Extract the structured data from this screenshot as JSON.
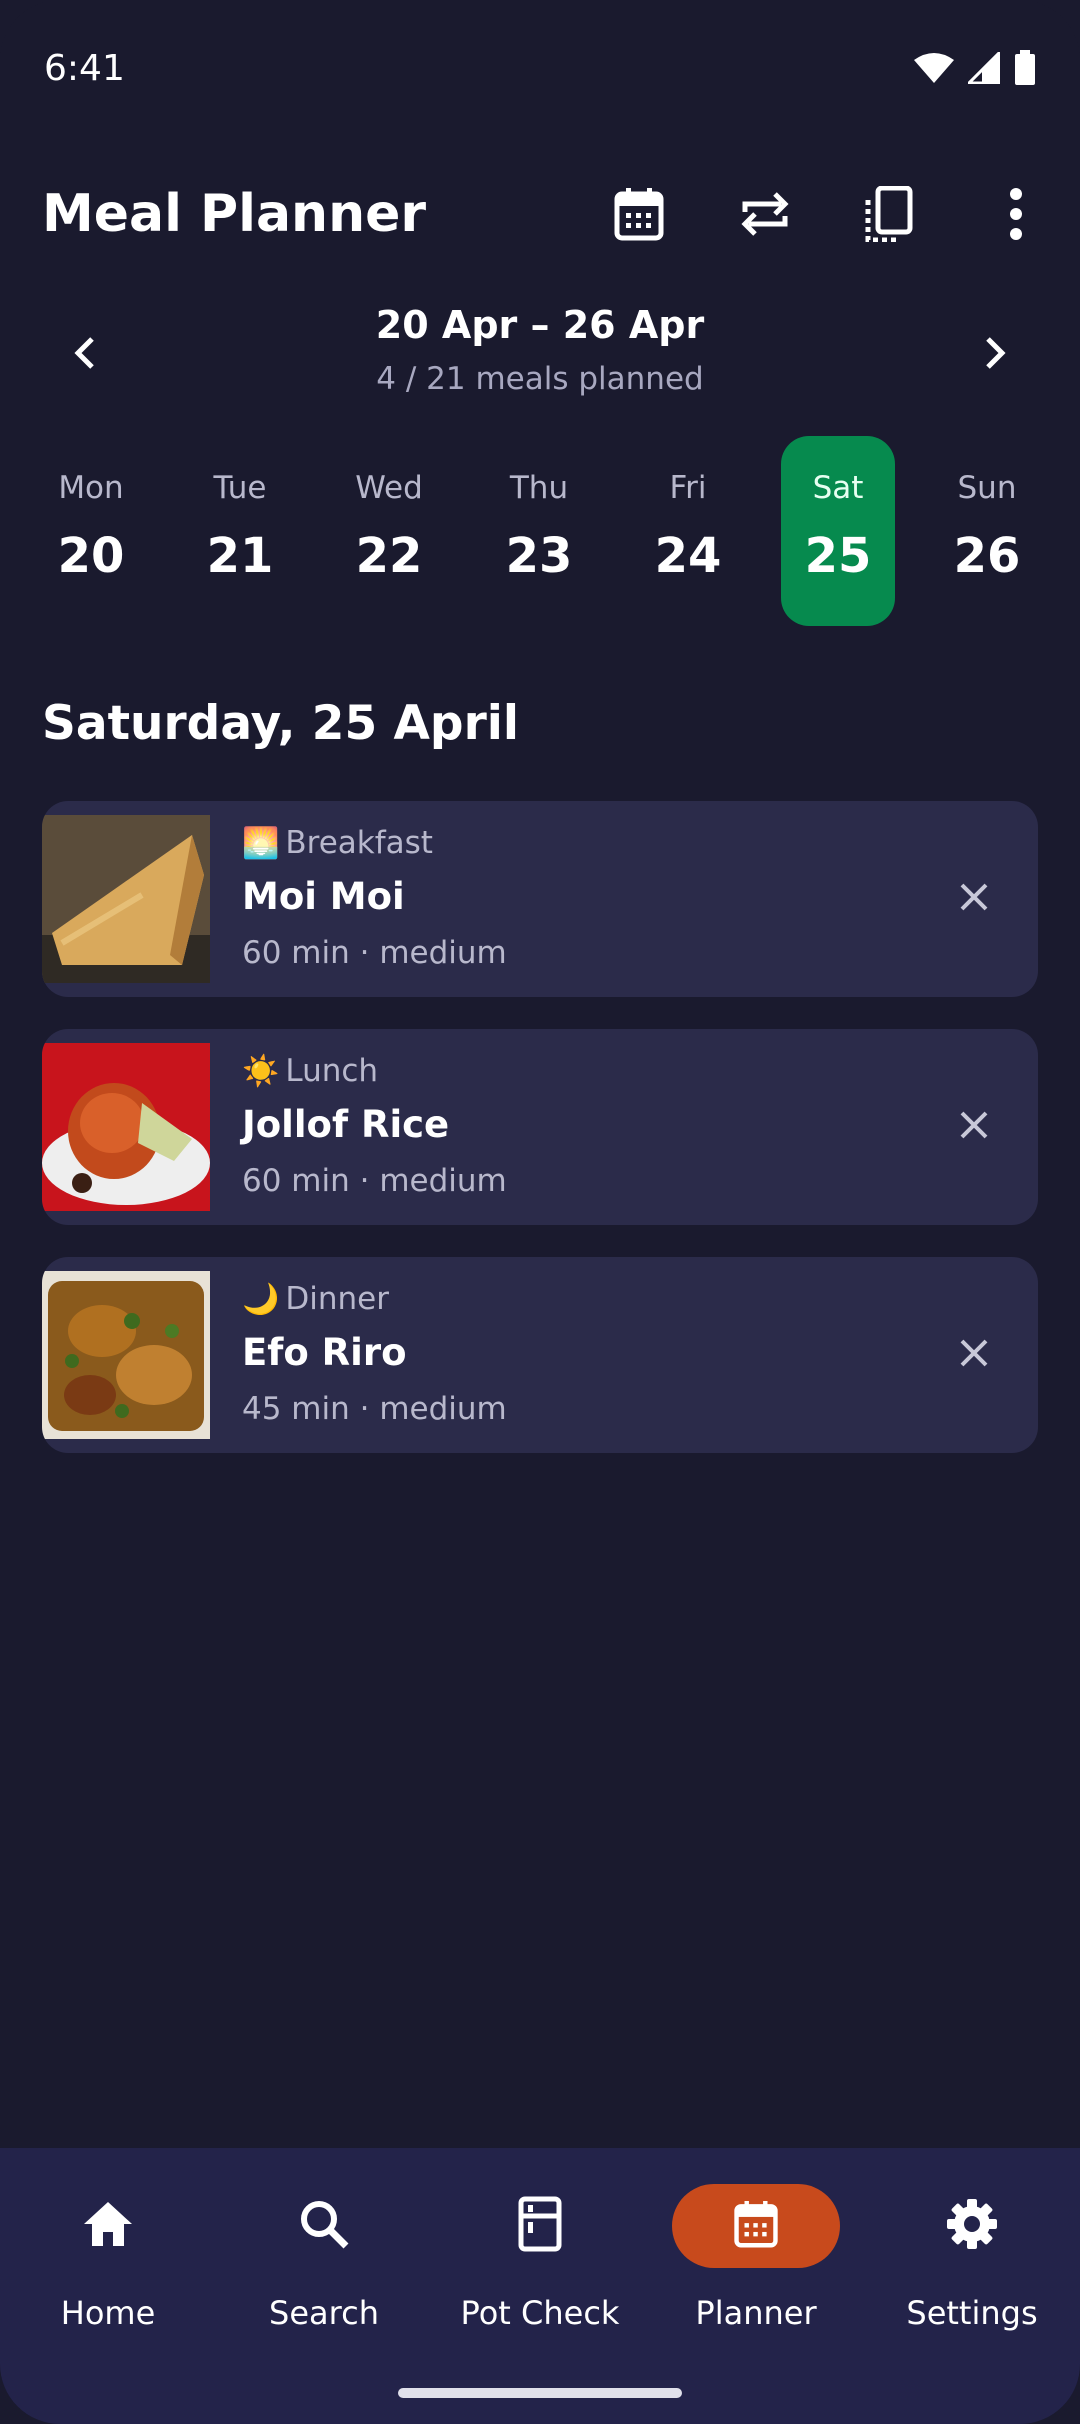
{
  "status_bar": {
    "time": "6:41"
  },
  "app_bar": {
    "title": "Meal Planner",
    "actions": [
      "calendar-icon",
      "repeat-icon",
      "copy-icon",
      "more-vert-icon"
    ]
  },
  "week": {
    "range": "20 Apr – 26 Apr",
    "planned": "4 / 21 meals planned"
  },
  "days": [
    {
      "name": "Mon",
      "num": "20",
      "selected": false
    },
    {
      "name": "Tue",
      "num": "21",
      "selected": false
    },
    {
      "name": "Wed",
      "num": "22",
      "selected": false
    },
    {
      "name": "Thu",
      "num": "23",
      "selected": false
    },
    {
      "name": "Fri",
      "num": "24",
      "selected": false
    },
    {
      "name": "Sat",
      "num": "25",
      "selected": true
    },
    {
      "name": "Sun",
      "num": "26",
      "selected": false
    }
  ],
  "date_heading": "Saturday, 25 April",
  "meals": [
    {
      "emoji": "🌅",
      "type": "Breakfast",
      "name": "Moi Moi",
      "meta": "60 min · medium"
    },
    {
      "emoji": "☀️",
      "type": "Lunch",
      "name": "Jollof Rice",
      "meta": "60 min · medium"
    },
    {
      "emoji": "🌙",
      "type": "Dinner",
      "name": "Efo Riro",
      "meta": "45 min · medium"
    }
  ],
  "nav": [
    {
      "label": "Home",
      "icon": "home-icon",
      "active": false
    },
    {
      "label": "Search",
      "icon": "search-icon",
      "active": false
    },
    {
      "label": "Pot Check",
      "icon": "fridge-icon",
      "active": false
    },
    {
      "label": "Planner",
      "icon": "calendar-icon",
      "active": true
    },
    {
      "label": "Settings",
      "icon": "gear-icon",
      "active": false
    }
  ],
  "colors": {
    "background": "#1a1a2e",
    "card": "#2b2b4a",
    "selected_day": "#068a4e",
    "nav_active": "#c84a1c",
    "nav_bar": "#23234a"
  }
}
